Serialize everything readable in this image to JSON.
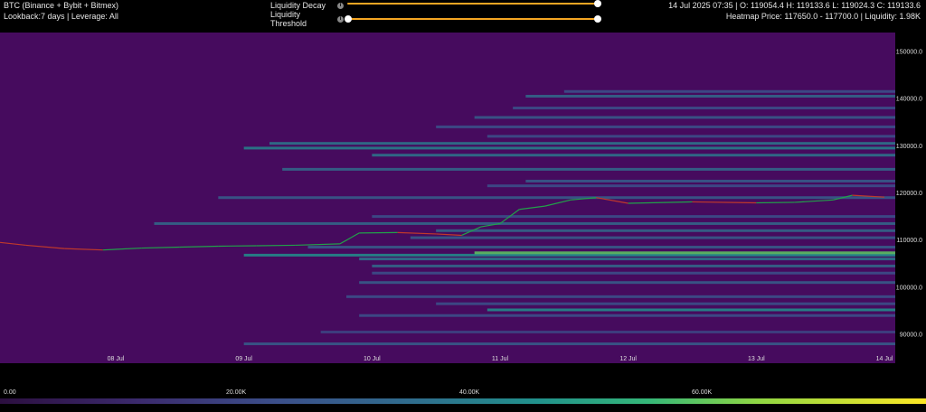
{
  "header": {
    "symbol": "BTC (Binance + Bybit + Bitmex)",
    "params": "Lookback:7 days | Leverage: All",
    "ohlc": "14 Jul 2025 07:35 | O: 119054.4 H: 119133.6 L: 119024.3 C: 119133.6",
    "heatmap_info": "Heatmap Price: 117650.0 - 117700.0 | Liquidity: 1.98K"
  },
  "controls": {
    "decay_label": "Liquidity Decay",
    "threshold_label": "Liquidity Threshold",
    "decay_value": 1.0,
    "threshold_value": 1.0
  },
  "legend": {
    "ticks": [
      "0.00",
      "20.00K",
      "40.00K",
      "60.00K"
    ]
  },
  "colors": {
    "background": "#460b5e",
    "price_up": "#22a14a",
    "price_down": "#c0392b",
    "slider": "#f5a623"
  },
  "chart_data": {
    "type": "heatmap",
    "x_ticks": [
      "08 Jul",
      "09 Jul",
      "10 Jul",
      "11 Jul",
      "12 Jul",
      "13 Jul",
      "14 Jul"
    ],
    "y_ticks": [
      90000.0,
      100000.0,
      110000.0,
      120000.0,
      130000.0,
      140000.0,
      150000.0
    ],
    "y_tick_labels": [
      "90000.0",
      "100000.0",
      "110000.0",
      "120000.0",
      "130000.0",
      "140000.0",
      "150000.0"
    ],
    "ylim": [
      86000,
      154000
    ],
    "xlim": [
      0,
      7
    ],
    "price_series": [
      [
        0.0,
        109500
      ],
      [
        0.3,
        108900
      ],
      [
        0.6,
        108200
      ],
      [
        0.9,
        107900
      ],
      [
        1.2,
        108300
      ],
      [
        1.5,
        108500
      ],
      [
        1.8,
        108700
      ],
      [
        2.1,
        108800
      ],
      [
        2.4,
        108900
      ],
      [
        2.75,
        109200
      ],
      [
        2.9,
        111500
      ],
      [
        3.2,
        111600
      ],
      [
        3.5,
        111300
      ],
      [
        3.7,
        111000
      ],
      [
        3.85,
        112800
      ],
      [
        4.0,
        113500
      ],
      [
        4.15,
        116500
      ],
      [
        4.35,
        117200
      ],
      [
        4.55,
        118500
      ],
      [
        4.75,
        119000
      ],
      [
        5.0,
        117800
      ],
      [
        5.5,
        118100
      ],
      [
        6.0,
        117900
      ],
      [
        6.3,
        118000
      ],
      [
        6.6,
        118500
      ],
      [
        6.75,
        119500
      ],
      [
        7.0,
        119100
      ]
    ],
    "bands": [
      {
        "price": 88000,
        "start": 2.0,
        "intensity": 0.35
      },
      {
        "price": 90500,
        "start": 2.6,
        "intensity": 0.25
      },
      {
        "price": 94000,
        "start": 2.9,
        "intensity": 0.3
      },
      {
        "price": 95200,
        "start": 3.9,
        "intensity": 0.55
      },
      {
        "price": 96500,
        "start": 3.5,
        "intensity": 0.3
      },
      {
        "price": 98000,
        "start": 2.8,
        "intensity": 0.3
      },
      {
        "price": 101000,
        "start": 2.9,
        "intensity": 0.35
      },
      {
        "price": 103000,
        "start": 3.0,
        "intensity": 0.3
      },
      {
        "price": 104500,
        "start": 3.0,
        "intensity": 0.4
      },
      {
        "price": 106000,
        "start": 2.9,
        "intensity": 0.45
      },
      {
        "price": 106800,
        "start": 2.0,
        "intensity": 0.55
      },
      {
        "price": 107300,
        "start": 3.8,
        "intensity": 0.8
      },
      {
        "price": 108500,
        "start": 2.5,
        "intensity": 0.35
      },
      {
        "price": 110500,
        "start": 3.3,
        "intensity": 0.35
      },
      {
        "price": 112000,
        "start": 3.5,
        "intensity": 0.4
      },
      {
        "price": 113500,
        "start": 1.3,
        "intensity": 0.4
      },
      {
        "price": 115000,
        "start": 3.0,
        "intensity": 0.3
      },
      {
        "price": 119000,
        "start": 1.8,
        "intensity": 0.35
      },
      {
        "price": 121500,
        "start": 3.9,
        "intensity": 0.3
      },
      {
        "price": 122500,
        "start": 4.2,
        "intensity": 0.35
      },
      {
        "price": 125000,
        "start": 2.3,
        "intensity": 0.4
      },
      {
        "price": 128000,
        "start": 3.0,
        "intensity": 0.45
      },
      {
        "price": 129500,
        "start": 2.0,
        "intensity": 0.5
      },
      {
        "price": 130500,
        "start": 2.2,
        "intensity": 0.45
      },
      {
        "price": 132000,
        "start": 3.9,
        "intensity": 0.3
      },
      {
        "price": 134000,
        "start": 3.5,
        "intensity": 0.3
      },
      {
        "price": 136000,
        "start": 3.8,
        "intensity": 0.35
      },
      {
        "price": 138000,
        "start": 4.1,
        "intensity": 0.3
      },
      {
        "price": 140500,
        "start": 4.2,
        "intensity": 0.4
      },
      {
        "price": 141500,
        "start": 4.5,
        "intensity": 0.3
      }
    ]
  }
}
